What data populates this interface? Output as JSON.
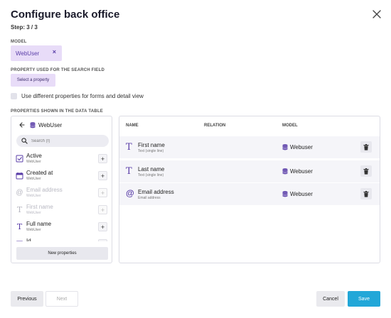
{
  "dialog": {
    "title": "Configure back office",
    "step": "Step: 3 / 3"
  },
  "model": {
    "label": "MODEL",
    "chip": "WebUser",
    "remove": "×"
  },
  "search_property": {
    "label": "PROPERTY USED FOR THE SEARCH FIELD",
    "button": "Select a property"
  },
  "checkbox": {
    "label": "Use different properties for forms and detail view",
    "checked": false
  },
  "properties_section": {
    "label": "PROPERTIES SHOWN IN THE DATA TABLE"
  },
  "left_panel": {
    "header": "WebUser",
    "search_placeholder": "Search (f)",
    "items": [
      {
        "name": "Active",
        "sub": "WebUser",
        "icon": "checkbox-icon",
        "disabled": false
      },
      {
        "name": "Created at",
        "sub": "WebUser",
        "icon": "calendar-icon",
        "disabled": false
      },
      {
        "name": "Email address",
        "sub": "WebUser",
        "icon": "at-icon",
        "disabled": true
      },
      {
        "name": "First name",
        "sub": "WebUser",
        "icon": "text-icon",
        "disabled": true
      },
      {
        "name": "Full name",
        "sub": "WebUser",
        "icon": "text-icon",
        "disabled": false
      },
      {
        "name": "Id",
        "sub": "",
        "icon": "id-icon",
        "disabled": false
      }
    ],
    "new_button": "New properties"
  },
  "table": {
    "columns": [
      "NAME",
      "RELATION",
      "MODEL"
    ],
    "rows": [
      {
        "name": "First name",
        "sub": "Text (single line)",
        "icon": "text-icon",
        "relation": "",
        "model": "Webuser"
      },
      {
        "name": "Last name",
        "sub": "Text (single line)",
        "icon": "text-icon",
        "relation": "",
        "model": "Webuser"
      },
      {
        "name": "Email address",
        "sub": "Email address",
        "icon": "at-icon",
        "relation": "",
        "model": "Webuser"
      }
    ]
  },
  "footer": {
    "previous": "Previous",
    "next": "Next",
    "cancel": "Cancel",
    "save": "Save"
  },
  "colors": {
    "accent": "#5a3ea8",
    "chip_bg": "#e8dcf8",
    "save": "#22a7d8"
  }
}
